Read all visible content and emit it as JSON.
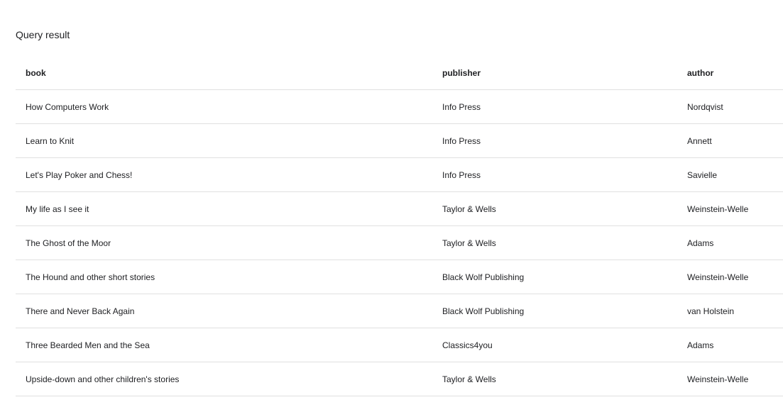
{
  "title": "Query result",
  "table": {
    "columns": [
      "book",
      "publisher",
      "author"
    ],
    "rows": [
      [
        "How Computers Work",
        "Info Press",
        "Nordqvist"
      ],
      [
        "Learn to Knit",
        "Info Press",
        "Annett"
      ],
      [
        "Let's Play Poker and Chess!",
        "Info Press",
        "Savielle"
      ],
      [
        "My life as I see it",
        "Taylor & Wells",
        "Weinstein-Welle"
      ],
      [
        "The Ghost of the Moor",
        "Taylor & Wells",
        "Adams"
      ],
      [
        "The Hound and other short stories",
        "Black Wolf Publishing",
        "Weinstein-Welle"
      ],
      [
        "There and Never Back Again",
        "Black Wolf Publishing",
        "van Holstein"
      ],
      [
        "Three Bearded Men and the Sea",
        "Classics4you",
        "Adams"
      ],
      [
        "Upside-down and other children's stories",
        "Taylor & Wells",
        "Weinstein-Welle"
      ]
    ]
  }
}
